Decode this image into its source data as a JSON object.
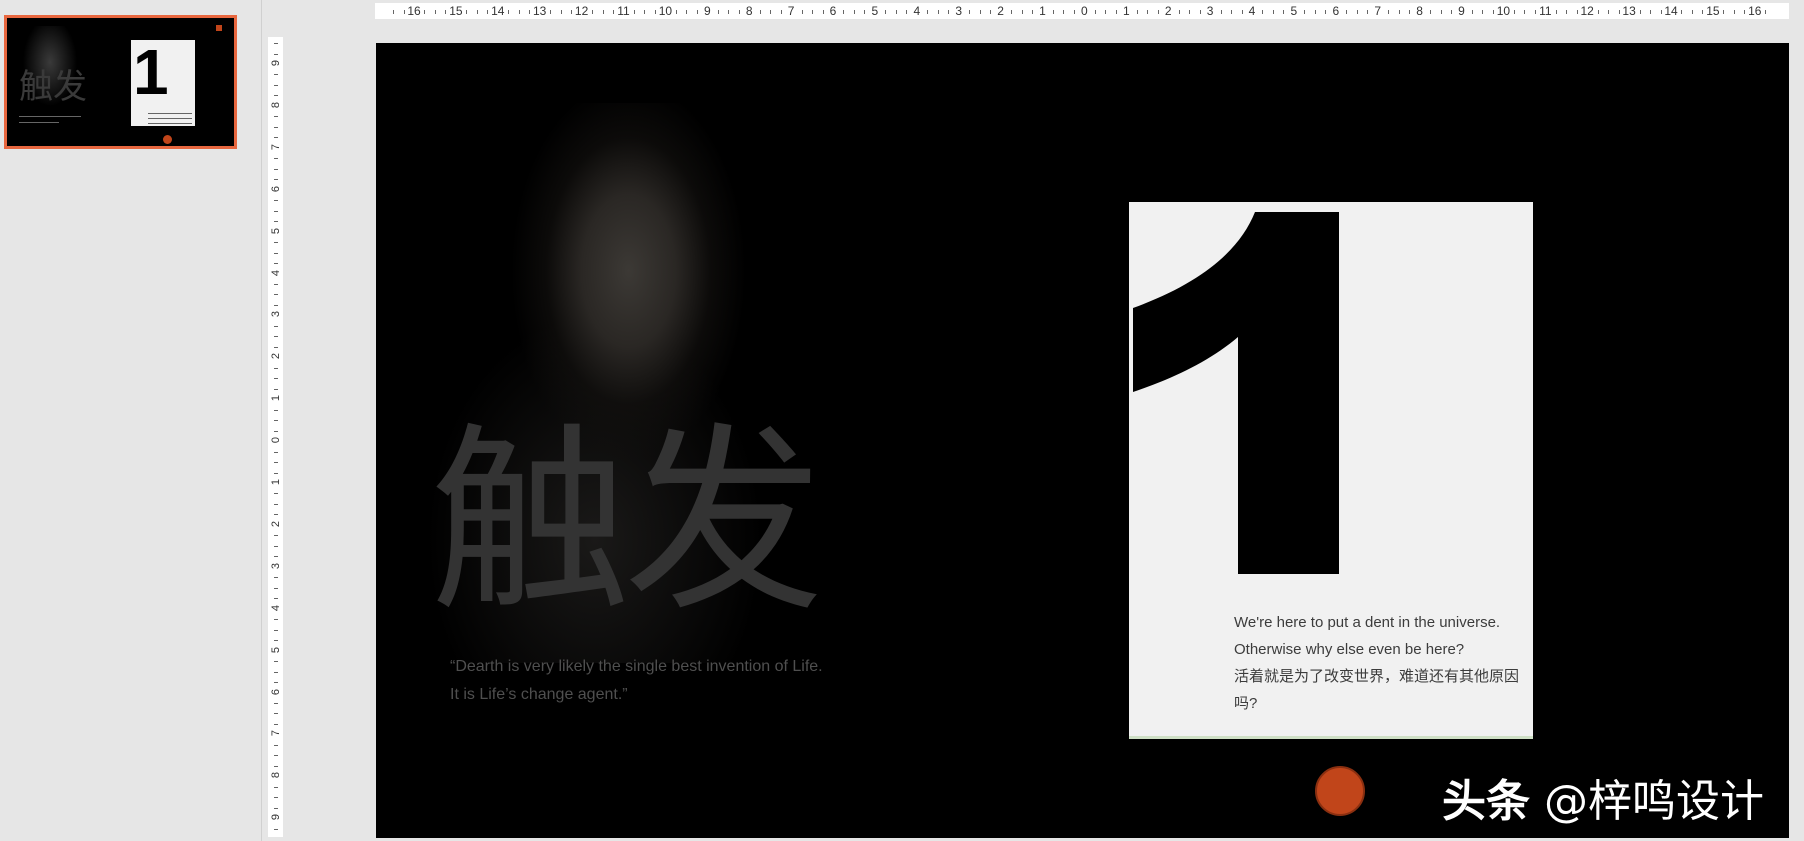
{
  "thumbnail": {
    "title": "触发"
  },
  "ruler": {
    "horizontal_labels": [
      "16",
      "15",
      "14",
      "13",
      "12",
      "11",
      "10",
      "9",
      "8",
      "7",
      "6",
      "5",
      "4",
      "3",
      "2",
      "1",
      "0",
      "1",
      "2",
      "3",
      "4",
      "5",
      "6",
      "7",
      "8",
      "9",
      "10",
      "11",
      "12",
      "13",
      "14",
      "15",
      "16"
    ],
    "vertical_labels": [
      "9",
      "8",
      "7",
      "6",
      "5",
      "4",
      "3",
      "2",
      "1",
      "0",
      "1",
      "2",
      "3",
      "4",
      "5",
      "6",
      "7",
      "8",
      "9"
    ]
  },
  "slide": {
    "big_title": "触发",
    "quote_line1": "“Dearth is very likely the single best invention of Life.",
    "quote_line2": "It is Life’s change agent.”",
    "card_number": "1",
    "card_line1": "We're here to put a dent in the universe.",
    "card_line2": "Otherwise why else even be here?",
    "card_line3": "活着就是为了改变世界，难道还有其他原因",
    "card_line4": "吗?",
    "watermark_bold": "头条",
    "watermark_text": "@梓鸣设计"
  },
  "colors": {
    "accent_orange": "#c1451a",
    "selection_border": "#e8673f",
    "slide_bg": "#000000",
    "card_bg": "#f1f1f1"
  }
}
